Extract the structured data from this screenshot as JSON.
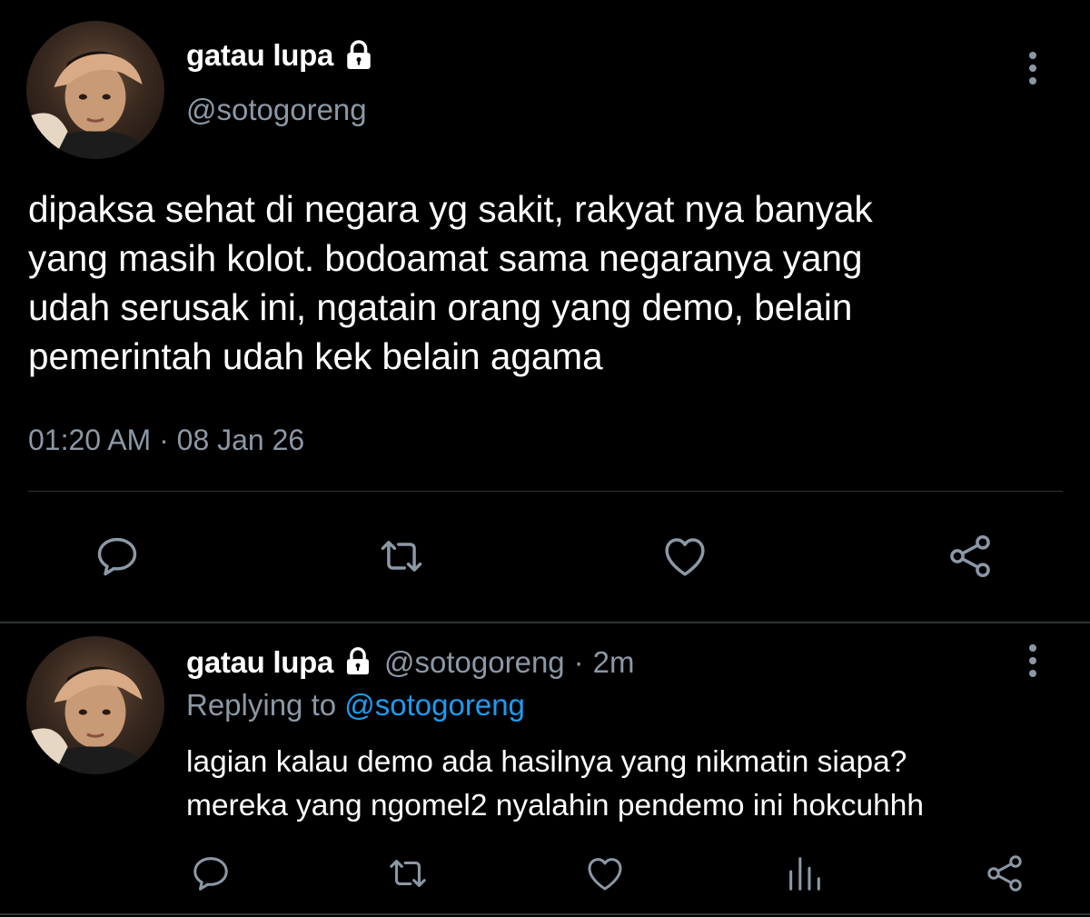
{
  "main_tweet": {
    "display_name": "gatau lupa",
    "handle": "@sotogoreng",
    "text": "dipaksa sehat di negara yg sakit, rakyat nya banyak\nyang masih kolot. bodoamat sama negaranya yang\nudah serusak ini, ngatain orang yang demo, belain\npemerintah udah kek belain agama",
    "timestamp": "01:20 AM · 08 Jan 26",
    "icons": {
      "protected": "lock-icon",
      "more": "more-vertical-icon",
      "reply": "reply-icon",
      "retweet": "retweet-icon",
      "like": "heart-icon",
      "share": "share-icon"
    }
  },
  "reply_tweet": {
    "display_name": "gatau lupa",
    "handle": "@sotogoreng",
    "separator": "·",
    "time_ago": "2m",
    "replying_prefix": "Replying to",
    "replying_to": "@sotogoreng",
    "text": "lagian kalau demo ada hasilnya yang nikmatin siapa?\nmereka yang ngomel2 nyalahin pendemo ini hokcuhhh",
    "icons": {
      "protected": "lock-icon",
      "more": "more-vertical-icon",
      "reply": "reply-icon",
      "retweet": "retweet-icon",
      "like": "heart-icon",
      "stats": "bar-chart-icon",
      "share": "share-icon"
    }
  },
  "colors": {
    "background": "#000000",
    "primary_text": "#ffffff",
    "secondary_text": "#8b98a5",
    "accent": "#1d9bf0",
    "divider": "#2f3336"
  }
}
